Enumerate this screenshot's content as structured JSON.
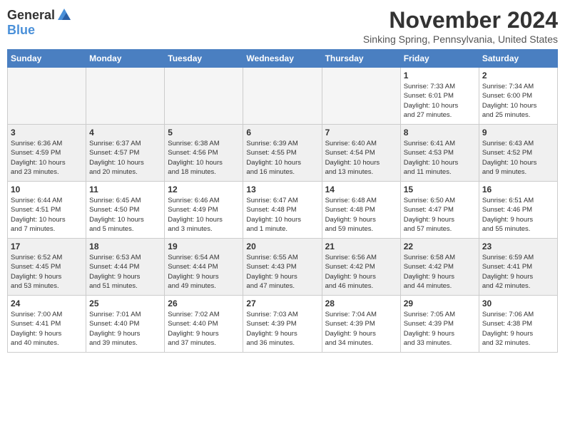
{
  "logo": {
    "general": "General",
    "blue": "Blue"
  },
  "header": {
    "month_title": "November 2024",
    "subtitle": "Sinking Spring, Pennsylvania, United States"
  },
  "weekdays": [
    "Sunday",
    "Monday",
    "Tuesday",
    "Wednesday",
    "Thursday",
    "Friday",
    "Saturday"
  ],
  "weeks": [
    [
      {
        "day": "",
        "info": ""
      },
      {
        "day": "",
        "info": ""
      },
      {
        "day": "",
        "info": ""
      },
      {
        "day": "",
        "info": ""
      },
      {
        "day": "",
        "info": ""
      },
      {
        "day": "1",
        "info": "Sunrise: 7:33 AM\nSunset: 6:01 PM\nDaylight: 10 hours\nand 27 minutes."
      },
      {
        "day": "2",
        "info": "Sunrise: 7:34 AM\nSunset: 6:00 PM\nDaylight: 10 hours\nand 25 minutes."
      }
    ],
    [
      {
        "day": "3",
        "info": "Sunrise: 6:36 AM\nSunset: 4:59 PM\nDaylight: 10 hours\nand 23 minutes."
      },
      {
        "day": "4",
        "info": "Sunrise: 6:37 AM\nSunset: 4:57 PM\nDaylight: 10 hours\nand 20 minutes."
      },
      {
        "day": "5",
        "info": "Sunrise: 6:38 AM\nSunset: 4:56 PM\nDaylight: 10 hours\nand 18 minutes."
      },
      {
        "day": "6",
        "info": "Sunrise: 6:39 AM\nSunset: 4:55 PM\nDaylight: 10 hours\nand 16 minutes."
      },
      {
        "day": "7",
        "info": "Sunrise: 6:40 AM\nSunset: 4:54 PM\nDaylight: 10 hours\nand 13 minutes."
      },
      {
        "day": "8",
        "info": "Sunrise: 6:41 AM\nSunset: 4:53 PM\nDaylight: 10 hours\nand 11 minutes."
      },
      {
        "day": "9",
        "info": "Sunrise: 6:43 AM\nSunset: 4:52 PM\nDaylight: 10 hours\nand 9 minutes."
      }
    ],
    [
      {
        "day": "10",
        "info": "Sunrise: 6:44 AM\nSunset: 4:51 PM\nDaylight: 10 hours\nand 7 minutes."
      },
      {
        "day": "11",
        "info": "Sunrise: 6:45 AM\nSunset: 4:50 PM\nDaylight: 10 hours\nand 5 minutes."
      },
      {
        "day": "12",
        "info": "Sunrise: 6:46 AM\nSunset: 4:49 PM\nDaylight: 10 hours\nand 3 minutes."
      },
      {
        "day": "13",
        "info": "Sunrise: 6:47 AM\nSunset: 4:48 PM\nDaylight: 10 hours\nand 1 minute."
      },
      {
        "day": "14",
        "info": "Sunrise: 6:48 AM\nSunset: 4:48 PM\nDaylight: 9 hours\nand 59 minutes."
      },
      {
        "day": "15",
        "info": "Sunrise: 6:50 AM\nSunset: 4:47 PM\nDaylight: 9 hours\nand 57 minutes."
      },
      {
        "day": "16",
        "info": "Sunrise: 6:51 AM\nSunset: 4:46 PM\nDaylight: 9 hours\nand 55 minutes."
      }
    ],
    [
      {
        "day": "17",
        "info": "Sunrise: 6:52 AM\nSunset: 4:45 PM\nDaylight: 9 hours\nand 53 minutes."
      },
      {
        "day": "18",
        "info": "Sunrise: 6:53 AM\nSunset: 4:44 PM\nDaylight: 9 hours\nand 51 minutes."
      },
      {
        "day": "19",
        "info": "Sunrise: 6:54 AM\nSunset: 4:44 PM\nDaylight: 9 hours\nand 49 minutes."
      },
      {
        "day": "20",
        "info": "Sunrise: 6:55 AM\nSunset: 4:43 PM\nDaylight: 9 hours\nand 47 minutes."
      },
      {
        "day": "21",
        "info": "Sunrise: 6:56 AM\nSunset: 4:42 PM\nDaylight: 9 hours\nand 46 minutes."
      },
      {
        "day": "22",
        "info": "Sunrise: 6:58 AM\nSunset: 4:42 PM\nDaylight: 9 hours\nand 44 minutes."
      },
      {
        "day": "23",
        "info": "Sunrise: 6:59 AM\nSunset: 4:41 PM\nDaylight: 9 hours\nand 42 minutes."
      }
    ],
    [
      {
        "day": "24",
        "info": "Sunrise: 7:00 AM\nSunset: 4:41 PM\nDaylight: 9 hours\nand 40 minutes."
      },
      {
        "day": "25",
        "info": "Sunrise: 7:01 AM\nSunset: 4:40 PM\nDaylight: 9 hours\nand 39 minutes."
      },
      {
        "day": "26",
        "info": "Sunrise: 7:02 AM\nSunset: 4:40 PM\nDaylight: 9 hours\nand 37 minutes."
      },
      {
        "day": "27",
        "info": "Sunrise: 7:03 AM\nSunset: 4:39 PM\nDaylight: 9 hours\nand 36 minutes."
      },
      {
        "day": "28",
        "info": "Sunrise: 7:04 AM\nSunset: 4:39 PM\nDaylight: 9 hours\nand 34 minutes."
      },
      {
        "day": "29",
        "info": "Sunrise: 7:05 AM\nSunset: 4:39 PM\nDaylight: 9 hours\nand 33 minutes."
      },
      {
        "day": "30",
        "info": "Sunrise: 7:06 AM\nSunset: 4:38 PM\nDaylight: 9 hours\nand 32 minutes."
      }
    ]
  ]
}
